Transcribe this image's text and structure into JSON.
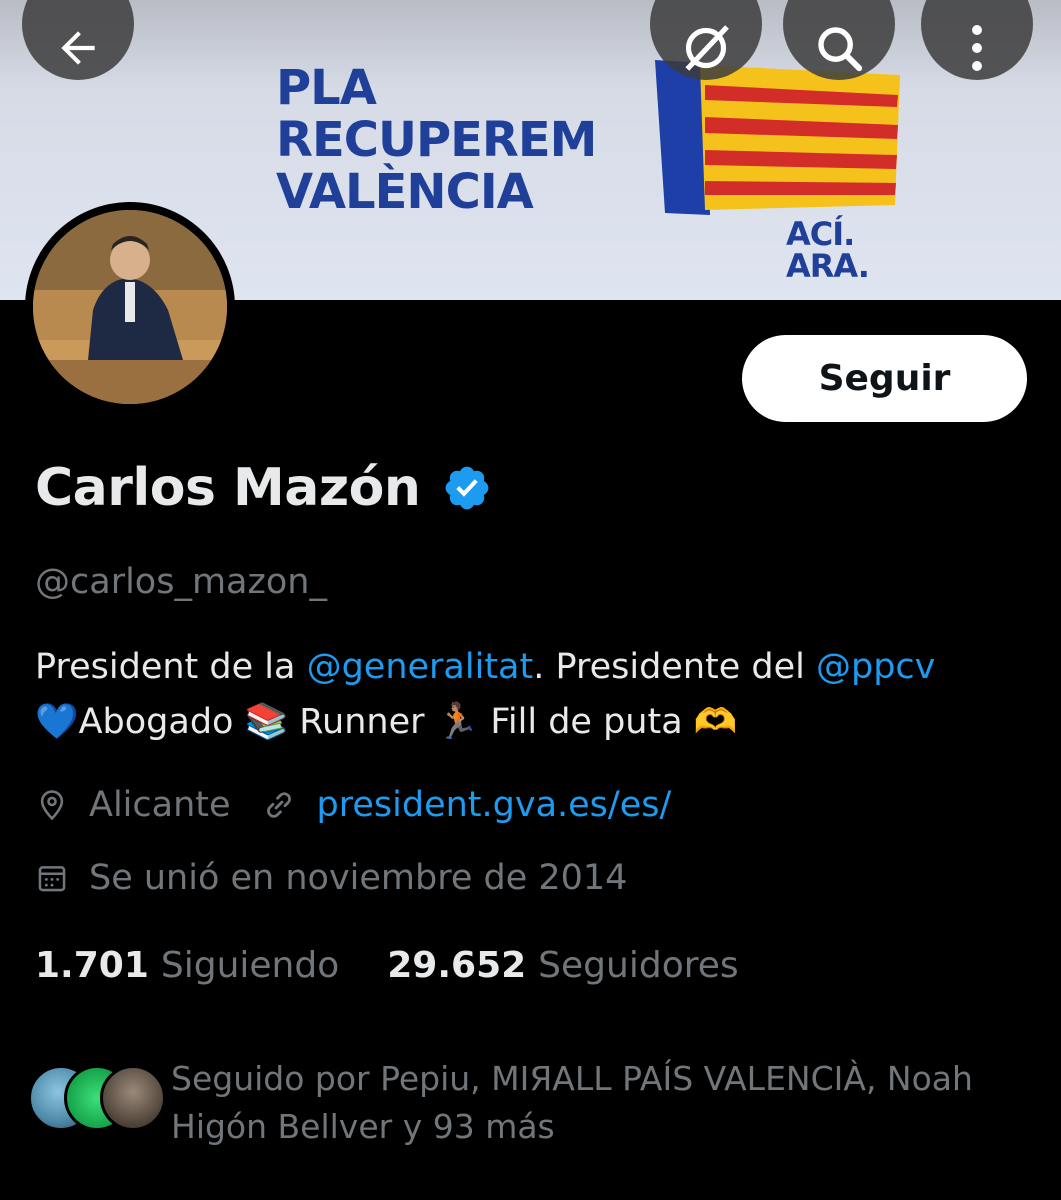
{
  "banner": {
    "line1": "PLA",
    "line2": "RECUPEREM",
    "line3": "VALÈNCIA",
    "tag_line1": "ACÍ.",
    "tag_line2": "ARA."
  },
  "toolbar": {
    "back_icon": "arrow-left-icon",
    "grok_icon": "grok-icon",
    "search_icon": "search-icon",
    "more_icon": "more-vertical-icon"
  },
  "profile": {
    "follow_label": "Seguir",
    "name": "Carlos Mazón",
    "handle": "@carlos_mazon_",
    "bio": {
      "part1": "President de la ",
      "mention1": "@generalitat",
      "part2": ". Presidente del ",
      "mention2": "@ppcv",
      "line2": "💙Abogado 📚 Runner 🏃🏽  Fill de puta 🫶"
    },
    "location": "Alicante",
    "website": "president.gva.es/es/",
    "joined": "Se unió en noviembre de 2014",
    "following_count": "1.701",
    "following_label": "Siguiendo",
    "followers_count": "29.652",
    "followers_label": "Seguidores",
    "followed_by": "Seguido por Pepiu, MIЯALL PAÍS VALENCIÀ, Noah Higón Bellver y 93 más"
  },
  "colors": {
    "accent": "#1d9bf0",
    "muted": "#71767b",
    "text": "#e7e9ea",
    "banner_blue": "#1f3f99"
  }
}
